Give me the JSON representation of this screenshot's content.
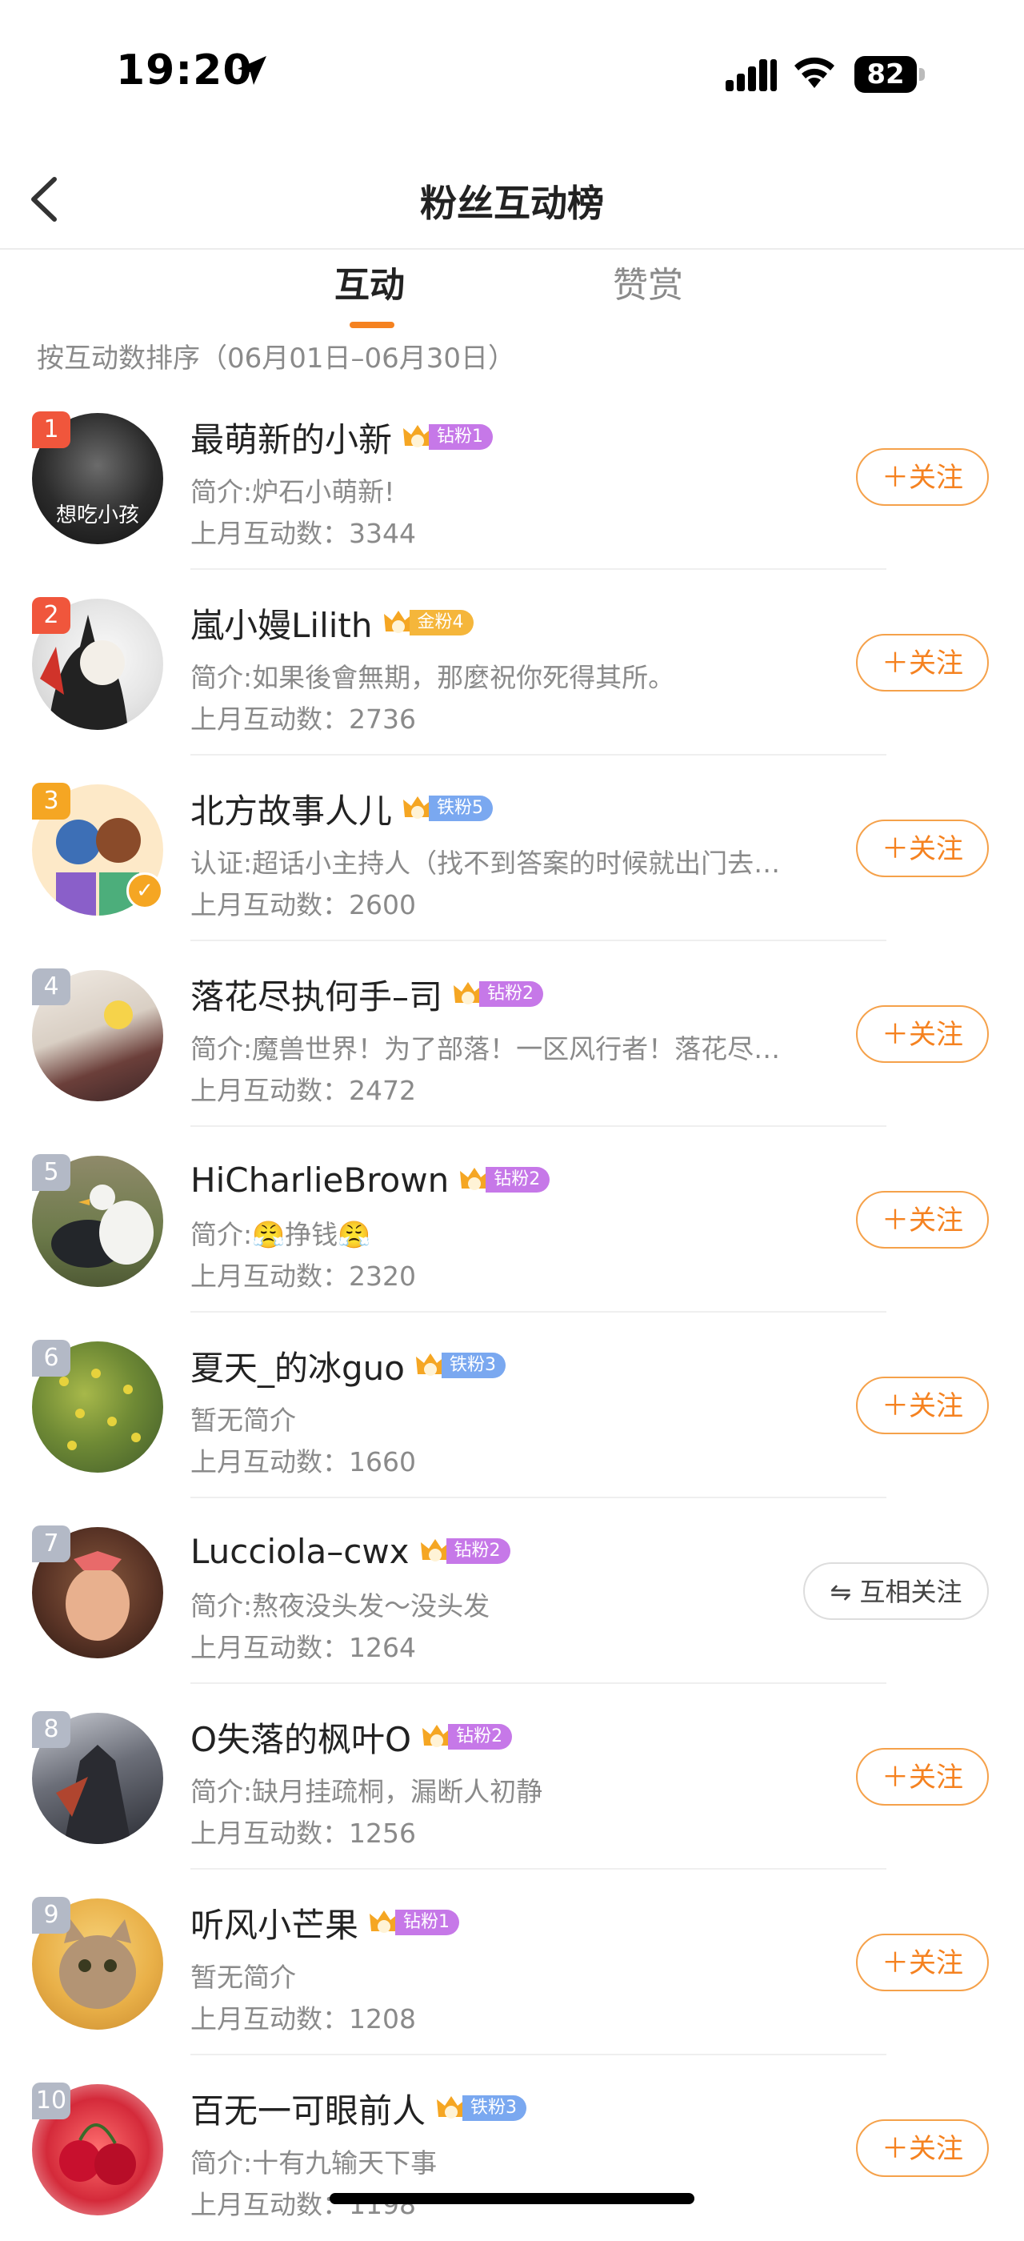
{
  "status_bar": {
    "time": "19:20",
    "battery": "82"
  },
  "nav": {
    "title": "粉丝互动榜"
  },
  "tabs": [
    {
      "label": "互动"
    },
    {
      "label": "赞赏"
    }
  ],
  "sort_label": "按互动数排序（06月01日–06月30日）",
  "rows": [
    {
      "rank": "1",
      "name": "最萌新的小新",
      "badge": "钻粉1",
      "bio": "简介:炉石小萌新!",
      "count": "上月互动数：3344",
      "button": "＋关注",
      "avatar_text": "想吃小孩"
    },
    {
      "rank": "2",
      "name": "嵐小嫚Lilith",
      "badge": "金粉4",
      "bio": "简介:如果後會無期，那麼祝你死得其所。",
      "count": "上月互动数：2736",
      "button": "＋关注"
    },
    {
      "rank": "3",
      "name": "北方故事人儿",
      "badge": "铁粉5",
      "bio": "认证:超话小主持人（找不到答案的时候就出门去…",
      "count": "上月互动数：2600",
      "button": "＋关注"
    },
    {
      "rank": "4",
      "name": "落花尽执何手–司",
      "badge": "钻粉2",
      "bio": "简介:魔兽世界！为了部落！一区风行者！落花尽…",
      "count": "上月互动数：2472",
      "button": "＋关注"
    },
    {
      "rank": "5",
      "name": "HiCharlieBrown",
      "badge": "钻粉2",
      "bio": "简介:😤挣钱😤",
      "count": "上月互动数：2320",
      "button": "＋关注"
    },
    {
      "rank": "6",
      "name": "夏天_的冰guo",
      "badge": "铁粉3",
      "bio": "暂无简介",
      "count": "上月互动数：1660",
      "button": "＋关注"
    },
    {
      "rank": "7",
      "name": "Lucciola–cwx",
      "badge": "钻粉2",
      "bio": "简介:熬夜没头发～没头发",
      "count": "上月互动数：1264",
      "button": "⇋ 互相关注"
    },
    {
      "rank": "8",
      "name": "O失落的枫叶O",
      "badge": "钻粉2",
      "bio": "简介:缺月挂疏桐，漏断人初静",
      "count": "上月互动数：1256",
      "button": "＋关注"
    },
    {
      "rank": "9",
      "name": "听风小芒果",
      "badge": "钻粉1",
      "bio": "暂无简介",
      "count": "上月互动数：1208",
      "button": "＋关注"
    },
    {
      "rank": "10",
      "name": "百无一可眼前人",
      "badge": "铁粉3",
      "bio": "简介:十有九输天下事",
      "count": "上月互动数：1198",
      "button": "＋关注"
    }
  ],
  "colors": {
    "accent": "#f58220",
    "badge_diamond": "#c678e8",
    "badge_gold": "#f5b63b",
    "badge_iron": "#7aa8f0",
    "rank_top": "#f0563c",
    "rank_other": "#b3b9c6"
  }
}
